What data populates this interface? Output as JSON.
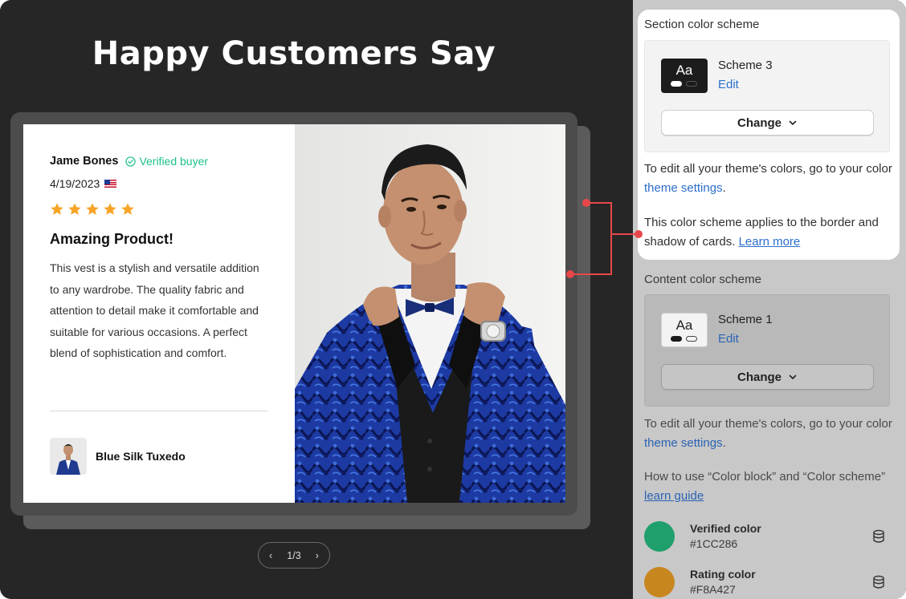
{
  "preview": {
    "title": "Happy Customers Say",
    "review": {
      "reviewer": "Jame Bones",
      "verified_label": "Verified buyer",
      "date": "4/19/2023",
      "rating": 5,
      "title": "Amazing Product!",
      "body": "This vest is a stylish and versatile addition to any wardrobe. The quality fabric and attention to detail make it comfortable and suitable for various occasions. A perfect blend of sophistication and comfort.",
      "product_name": "Blue Silk Tuxedo"
    },
    "pager": {
      "label": "1/3"
    }
  },
  "settings": {
    "section_scheme": {
      "label": "Section color scheme",
      "swatch_text": "Aa",
      "scheme_name": "Scheme 3",
      "edit_label": "Edit",
      "change_label": "Change"
    },
    "theme_note_1": {
      "before": "To edit all your theme's colors, go to your color ",
      "link": "theme settings",
      "after": "."
    },
    "scheme_note": {
      "before": "This color scheme applies to the border and shadow of cards. ",
      "link": "Learn more"
    },
    "content_scheme": {
      "label": "Content color scheme",
      "swatch_text": "Aa",
      "scheme_name": "Scheme 1",
      "edit_label": "Edit",
      "change_label": "Change"
    },
    "theme_note_2": {
      "before": "To edit all your theme's colors, go to your color ",
      "link": "theme settings",
      "after": "."
    },
    "guide_note": {
      "before": "How to use “Color block” and “Color scheme” ",
      "link": "learn guide"
    },
    "colors": [
      {
        "name": "Verified color",
        "hex": "#1CC286",
        "swatch": "#1f9f6c"
      },
      {
        "name": "Rating color",
        "hex": "#F8A427",
        "swatch": "#c8861f"
      }
    ]
  },
  "colors": {
    "verified": "#1CC286",
    "star": "#F8A427",
    "annotation": "#e8474a",
    "link": "#2c6ecb"
  }
}
